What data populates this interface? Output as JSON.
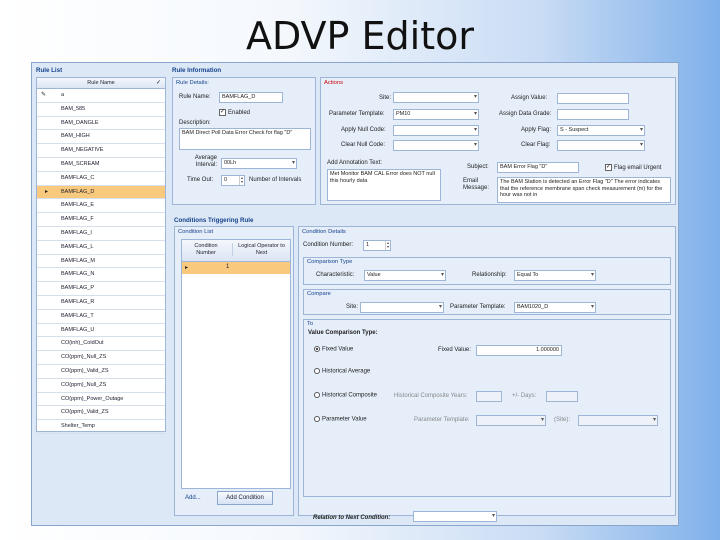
{
  "slide_title": "ADVP Editor",
  "rule_list": {
    "header": "Rule List",
    "column": "Rule Name",
    "filter_value": "a",
    "rows": [
      "BAM_585",
      "BAM_DANGLE",
      "BAM_HIGH",
      "BAM_NEGATIVE",
      "BAM_SCREAM",
      "BAMFLAG_C",
      "BAMFLAG_D",
      "BAMFLAG_E",
      "BAMFLAG_F",
      "BAMFLAG_I",
      "BAMFLAG_L",
      "BAMFLAG_M",
      "BAMFLAG_N",
      "BAMFLAG_P",
      "BAMFLAG_R",
      "BAMFLAG_T",
      "BAMFLAG_U",
      "CO(inh)_ColdOut",
      "CO(ppm)_Null_ZS",
      "CO(ppm)_Valid_ZS",
      "CO(ppm)_Null_ZS",
      "CO(ppm)_Power_Outage",
      "CO(ppm)_Valid_ZS",
      "Shelter_Temp"
    ],
    "selected_index": 6
  },
  "rule_info": {
    "header": "Rule Information",
    "details_header": "Rule Details:",
    "rule_name_label": "Rule Name:",
    "rule_name_value": "BAMFLAG_D",
    "enabled_label": "Enabled",
    "description_label": "Description:",
    "description_value": "BAM Direct Poll Data Error Check for flag \"D\"",
    "avg_interval_label": "Average Interval:",
    "avg_interval_value": "00Lh",
    "timeout_label": "Time Out:",
    "timeout_value": "0",
    "num_intervals_label": "Number of Intervals"
  },
  "actions": {
    "header": "Actions",
    "site_label": "Site:",
    "param_template_label": "Parameter Template:",
    "param_template_value": "PM10",
    "apply_null_label": "Apply Null Code:",
    "clear_null_label": "Clear Null Code:",
    "assign_value_label": "Assign Value:",
    "assign_data_grade_label": "Assign Data Grade:",
    "apply_flag_label": "Apply Flag:",
    "apply_flag_value": "S - Suspect",
    "clear_flag_label": "Clear Flag:",
    "add_annotation_label": "Add Annotation Text:",
    "annotation_value": "Met Monitor BAM CAL Error does NOT null this hourly data",
    "subject_label": "Subject:",
    "subject_value": "BAM Error Flag \"D\"",
    "flag_urgent_label": "Flag email Urgent",
    "email_message_label": "Email Message:",
    "email_message_value": "The BAM Station is detected an Error Flag \"D\" The error indicates that the reference membrane span check measurement (m) for the hour was not in"
  },
  "conditions": {
    "header": "Conditions Triggering Rule",
    "list_header": "Condition List",
    "col_condition": "Condition Number",
    "col_logical": "Logical Operator to Next",
    "row_number": "1",
    "add_link": "Add...",
    "add_button": "Add Condition",
    "details_header": "Condition Details",
    "condition_number_label": "Condition Number:",
    "condition_number_value": "1",
    "comparison_type_header": "Comparison Type",
    "characteristic_label": "Characteristic:",
    "characteristic_value": "Value",
    "relationship_label": "Relationship:",
    "relationship_value": "Equal To",
    "compare_header": "Compare",
    "site_label": "Site:",
    "param_template_label": "Parameter Template:",
    "param_template_value": "BAM1020_D",
    "to_header": "To",
    "value_comparison_label": "Value Comparison Type:",
    "fixed_value_radio": "Fixed Value",
    "fixed_value_label": "Fixed Value:",
    "fixed_value": "1.000000",
    "historical_average": "Historical Average",
    "historical_composite": "Historical Composite",
    "historical_composite_years": "Historical Composite Years:",
    "plus_minus_days": "+/- Days:",
    "parameter_value": "Parameter Value",
    "parameter_template": "Parameter Template:",
    "site_short": "(Site):",
    "relation_next": "Relation to Next Condition:"
  }
}
